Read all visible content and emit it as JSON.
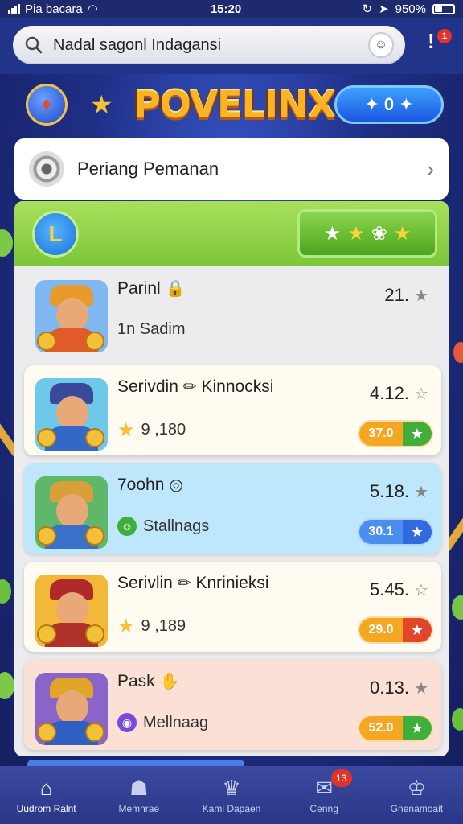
{
  "status_bar": {
    "carrier": "Pia bacara",
    "time": "15:20",
    "battery": "950%"
  },
  "search": {
    "query": "Nadal sagonl Indagansi",
    "icon": "search-icon"
  },
  "notification": {
    "count": "1"
  },
  "logo": {
    "text": "POVELINX"
  },
  "header_pill": {
    "label": "0"
  },
  "section": {
    "label": "Periang Pemanan"
  },
  "panel": {
    "header_icon_letter": "L"
  },
  "games": [
    {
      "title": "Parinl",
      "sub": "1n Sadim",
      "rating": "21.",
      "row_color": "#ececef",
      "hat": "#e89a2a",
      "body": "#e05a2a",
      "bg": "#7fb8f0"
    },
    {
      "title": "Serivdin",
      "title2": "Kinnocksi",
      "sub": "9 ,180",
      "rating": "4.12.",
      "chip": "37.0",
      "row_color": "#fffbf0",
      "chip_color": "#f5a623",
      "chip_sq": "#3fae3a",
      "hat": "#3a4a9a",
      "body": "#3468c8",
      "bg": "#6ec8e8"
    },
    {
      "title": "7oohn",
      "sub": "Stallnags",
      "rating": "5.18.",
      "chip": "30.1",
      "row_color": "#bfe7fb",
      "chip_color": "#4a8ef0",
      "chip_sq": "#2f6ae0",
      "hat": "#d9a03a",
      "body": "#3a70c8",
      "bg": "#5fb86a"
    },
    {
      "title": "Serivlin",
      "title2": "Knrinieksi",
      "sub": "9 ,189",
      "rating": "5.45.",
      "chip": "29.0",
      "row_color": "#fffbf0",
      "chip_color": "#f5a623",
      "chip_sq": "#e2452b",
      "hat": "#b02a2a",
      "body": "#b0302a",
      "bg": "#f3b83a"
    },
    {
      "title": "Pask",
      "sub": "Mellnaag",
      "rating": "0.13.",
      "chip": "52.0",
      "row_color": "#fbe0d6",
      "chip_color": "#f5a623",
      "chip_sq": "#3fae3a",
      "hat": "#e0a52a",
      "body": "#2f5fc0",
      "bg": "#8a64c8"
    }
  ],
  "nav": [
    {
      "label": "Uudrom Ralnt",
      "icon": "home-icon",
      "active": true
    },
    {
      "label": "Memnrae",
      "icon": "house-icon"
    },
    {
      "label": "Kami Dapaen",
      "icon": "crown-icon"
    },
    {
      "label": "Cenng",
      "icon": "chat-icon",
      "badge": "13"
    },
    {
      "label": "Gnenamoait",
      "icon": "trophy-icon"
    }
  ]
}
